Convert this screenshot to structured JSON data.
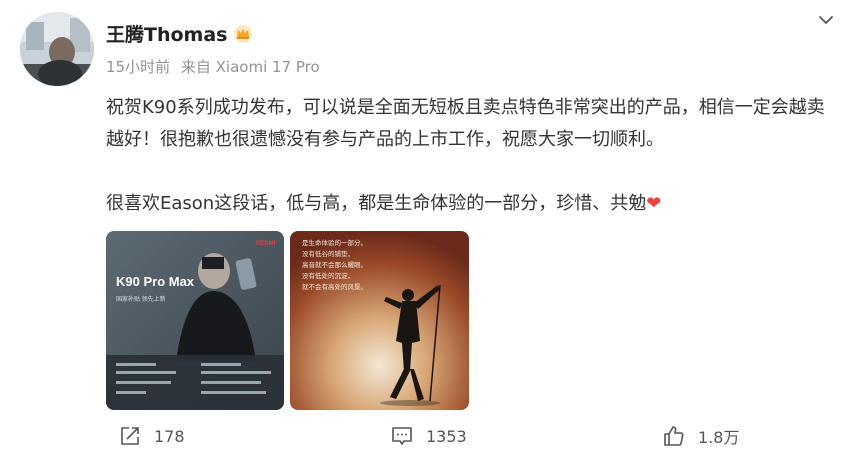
{
  "author": {
    "name": "王腾Thomas",
    "badge_icon": "crown-badge-icon"
  },
  "meta": {
    "time": "15小时前",
    "source": "来自 Xiaomi 17 Pro"
  },
  "post": {
    "paragraph1": "祝贺K90系列成功发布，可以说是全面无短板且卖点特色非常突出的产品，相信一定会越卖越好！很抱歉也很遗憾没有参与产品的上市工作，祝愿大家一切顺利。",
    "paragraph2": "很喜欢Eason这段话，低与高，都是生命体验的一部分，珍惜、共勉",
    "emoji": "❤"
  },
  "images": [
    {
      "title": "K90 Pro Max",
      "subtitle": "国家补贴 领先上新",
      "brand": "REDMI"
    },
    {
      "poem": [
        "是生命体验的一部分。",
        "没有低谷的铺垫，",
        "高音就不会那么耀眼。",
        "没有低处的沉淀，",
        "就不会有高处的风景。"
      ]
    }
  ],
  "actions": {
    "share_count": "178",
    "comment_count": "1353",
    "like_count": "1.8万"
  },
  "colors": {
    "accent_heart": "#e8453c",
    "meta_gray": "#939393",
    "crown_gold": "#f5a623"
  }
}
